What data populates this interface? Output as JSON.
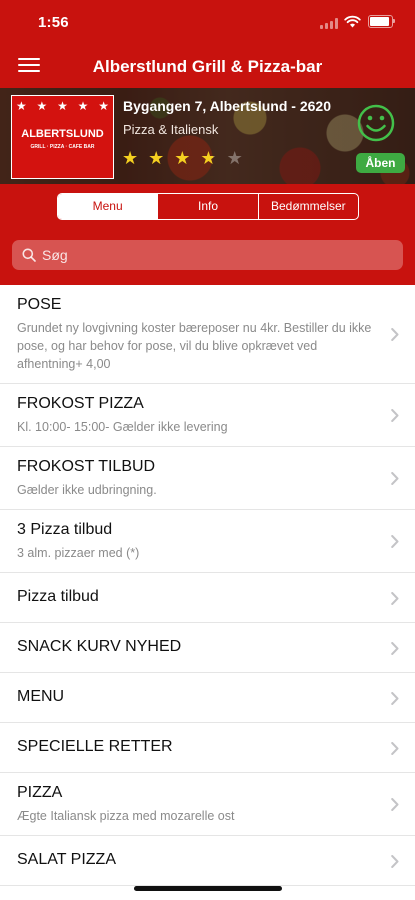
{
  "status_bar": {
    "time": "1:56"
  },
  "app": {
    "title": "Alberstlund Grill & Pizza-bar"
  },
  "restaurant": {
    "logo_name": "ALBERTSLUND",
    "logo_subtitle": "GRILL · PIZZA · CAFE BAR",
    "address": "Bygangen 7, Albertslund - 2620",
    "cuisine": "Pizza & Italiensk",
    "rating": 3.5,
    "rating_max": 5,
    "status": "Åben"
  },
  "tabs": [
    {
      "label": "Menu",
      "active": true
    },
    {
      "label": "Info",
      "active": false
    },
    {
      "label": "Bedømmelser",
      "active": false
    }
  ],
  "search": {
    "placeholder": "Søg"
  },
  "menu": [
    {
      "title": "POSE",
      "description": "Grundet ny lovgivning koster bæreposer nu 4kr. Bestiller du ikke pose, og har behov for pose, vil du blive opkrævet ved afhentning+ 4,00"
    },
    {
      "title": "FROKOST PIZZA",
      "description": "Kl. 10:00- 15:00- Gælder ikke levering"
    },
    {
      "title": "FROKOST TILBUD",
      "description": "Gælder ikke udbringning."
    },
    {
      "title": "3 Pizza tilbud",
      "description": "3 alm. pizzaer med (*)"
    },
    {
      "title": "Pizza tilbud",
      "description": ""
    },
    {
      "title": "SNACK KURV NYHED",
      "description": ""
    },
    {
      "title": "MENU",
      "description": ""
    },
    {
      "title": "SPECIELLE RETTER",
      "description": ""
    },
    {
      "title": "PIZZA",
      "description": "Ægte Italiansk pizza med mozarelle ost"
    },
    {
      "title": "SALAT PIZZA",
      "description": ""
    }
  ],
  "colors": {
    "brand": "#c8120e",
    "open": "#3eaa42",
    "star": "#f5d020",
    "smiley": "#43c04a"
  },
  "icons": [
    "menu-icon",
    "search-icon",
    "chevron-right-icon",
    "smiley-icon",
    "star-icon",
    "wifi-icon",
    "battery-icon"
  ]
}
